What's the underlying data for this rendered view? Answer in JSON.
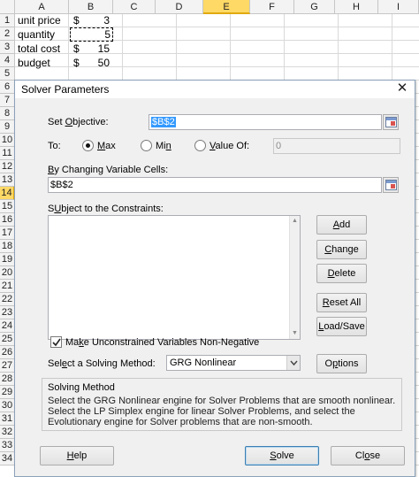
{
  "spreadsheet": {
    "columns": [
      "A",
      "B",
      "C",
      "D",
      "E",
      "F",
      "G",
      "H",
      "I"
    ],
    "selected_column": "E",
    "rows": [
      "1",
      "2",
      "3",
      "4",
      "5",
      "6",
      "7",
      "8",
      "9",
      "10",
      "11",
      "12",
      "13",
      "14",
      "15",
      "16",
      "17",
      "18",
      "19",
      "20",
      "21",
      "22",
      "23",
      "24",
      "25",
      "26",
      "27",
      "28",
      "29",
      "30",
      "31",
      "32",
      "33",
      "34"
    ],
    "selected_row": "14",
    "cells": {
      "a1": "unit price",
      "b1_currency": "$",
      "b1_value": "3",
      "a2": "quantity",
      "b2_value": "5",
      "a3": "total cost",
      "b3_currency": "$",
      "b3_value": "15",
      "a4": "budget",
      "b4_currency": "$",
      "b4_value": "50"
    }
  },
  "dialog": {
    "title": "Solver Parameters",
    "close_glyph": "✕",
    "set_objective": {
      "prefix": "Set ",
      "accel": "O",
      "rest": "bjective:",
      "value": "$B$2"
    },
    "to": {
      "label": "To:",
      "max": {
        "accel": "M",
        "rest": "ax"
      },
      "min": {
        "prefix": "Mi",
        "accel": "n",
        "rest": ""
      },
      "value_of": {
        "accel": "V",
        "rest": "alue Of:",
        "value": "0"
      },
      "selected": "max"
    },
    "changing_cells": {
      "accel": "B",
      "rest": "y Changing Variable Cells:",
      "value": "$B$2"
    },
    "constraints": {
      "accel": "U",
      "prefix": "S",
      "rest": "bject to the Constraints:"
    },
    "buttons": {
      "add": {
        "accel": "A",
        "rest": "dd"
      },
      "change": {
        "accel": "C",
        "rest": "hange"
      },
      "delete": {
        "accel": "D",
        "rest": "elete"
      },
      "reset_all": {
        "accel": "R",
        "rest": "eset All"
      },
      "load_save": {
        "accel": "L",
        "rest": "oad/Save"
      },
      "options": {
        "accel": "p",
        "prefix": "O",
        "rest": "tions"
      },
      "help": {
        "accel": "H",
        "rest": "elp"
      },
      "solve": {
        "accel": "S",
        "rest": "olve"
      },
      "close": {
        "accel": "o",
        "prefix": "Cl",
        "rest": "se"
      }
    },
    "nonnegative": {
      "accel": "k",
      "prefix": "Ma",
      "rest": "e Unconstrained Variables Non-Negative",
      "checked": true
    },
    "solving_method": {
      "prefix": "Sel",
      "accel": "e",
      "rest": "ct a Solving Method:",
      "value": "GRG Nonlinear"
    },
    "method_group": {
      "title": "Solving Method",
      "text": "Select the GRG Nonlinear engine for Solver Problems that are smooth nonlinear. Select the LP Simplex engine for linear Solver Problems, and select the Evolutionary engine for Solver problems that are non-smooth."
    }
  },
  "colors": {
    "selected_header": "#ffd966",
    "selection_highlight": "#3399ff",
    "default_button_border": "#3c7fb1"
  }
}
